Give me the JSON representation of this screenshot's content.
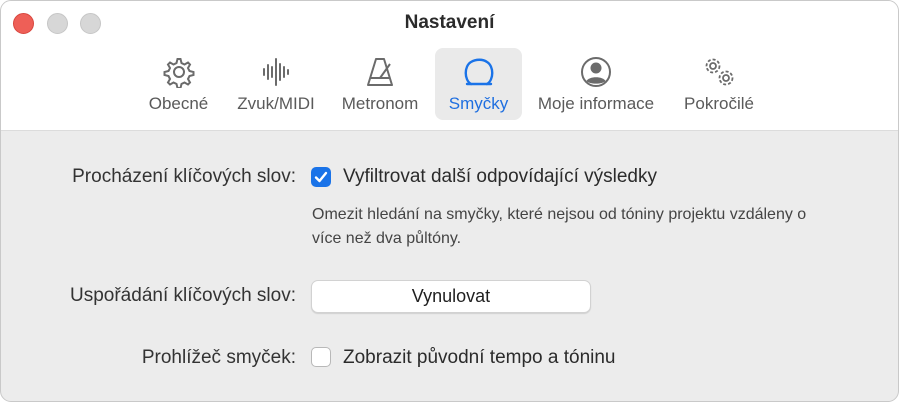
{
  "window": {
    "title": "Nastavení",
    "tabs": [
      {
        "label": "Obecné",
        "icon": "gear-icon"
      },
      {
        "label": "Zvuk/MIDI",
        "icon": "waveform-icon"
      },
      {
        "label": "Metronom",
        "icon": "metronome-icon"
      },
      {
        "label": "Smyčky",
        "icon": "loop-icon",
        "selected": true
      },
      {
        "label": "Moje informace",
        "icon": "person-circle-icon"
      },
      {
        "label": "Pokročilé",
        "icon": "gears-icon"
      }
    ]
  },
  "settings": {
    "keyword_browsing": {
      "label": "Procházení klíčových slov:",
      "checkbox_label": "Vyfiltrovat další odpovídající výsledky",
      "checked": true,
      "help_text": "Omezit hledání na smyčky, které nejsou od tóniny projektu vzdáleny o více než dva půltóny."
    },
    "keyword_layout": {
      "label": "Uspořádání klíčových slov:",
      "button_label": "Vynulovat"
    },
    "loop_browser": {
      "label": "Prohlížeč smyček:",
      "checkbox_label": "Zobrazit původní tempo a tóninu",
      "checked": false
    }
  },
  "colors": {
    "accent": "#1a73e8",
    "close": "#ee5f57"
  }
}
